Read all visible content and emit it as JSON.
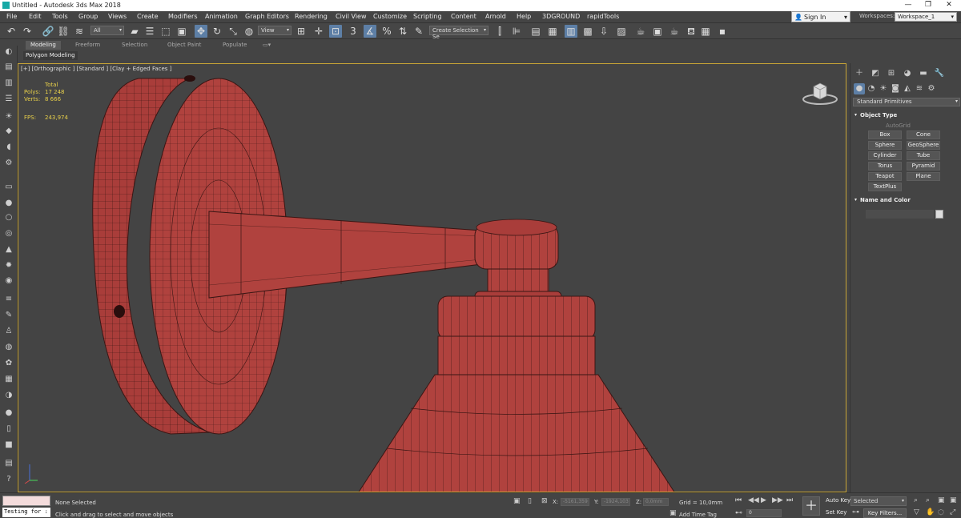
{
  "window": {
    "title": "Untitled - Autodesk 3ds Max 2018",
    "controls": [
      "—",
      "❐",
      "✕"
    ]
  },
  "menubar": {
    "items": [
      "File",
      "Edit",
      "Tools",
      "Group",
      "Views",
      "Create",
      "Modifiers",
      "Animation",
      "Graph Editors",
      "Rendering",
      "Civil View",
      "Customize",
      "Scripting",
      "Content",
      "Arnold",
      "Help",
      "3DGROUND",
      "rapidTools"
    ],
    "sign_in": "Sign In",
    "workspaces_label": "Workspaces:",
    "workspace_value": "Workspace_1"
  },
  "toolbar": {
    "filter_value": "All",
    "ref_coord_value": "View",
    "named_selection_value": "Create Selection Se",
    "icons": [
      "undo-icon",
      "redo-icon",
      "link-icon",
      "unlink-icon",
      "bind-spacewarp-icon",
      "select-object-icon",
      "select-by-name-icon",
      "rect-selection-icon",
      "window-crossing-icon",
      "move-icon",
      "rotate-icon",
      "scale-icon",
      "place-icon",
      "pivot-icon",
      "manipulate-icon",
      "keyboard-shortcut-icon",
      "snaps-icon",
      "angle-snap-icon",
      "percent-snap-icon",
      "spinner-snap-icon",
      "mirror-icon",
      "align-icon",
      "layer-explorer-icon",
      "toggle-ribbon-icon",
      "scene-explorer-icon",
      "curve-editor-icon",
      "schematic-view-icon",
      "material-editor-icon",
      "render-setup-icon",
      "rendered-frame-icon",
      "render-icon",
      "render-iterative-icon",
      "max-script-icon"
    ]
  },
  "ribbon": {
    "tabs": [
      "Modeling",
      "Freeform",
      "Selection",
      "Object Paint",
      "Populate"
    ],
    "active_tab": "Modeling",
    "sub_label": "Polygon Modeling"
  },
  "viewport": {
    "label": "[+] [Orthographic ] [Standard ] [Clay + Edged Faces ]",
    "stats": {
      "total_label": "Total",
      "polys_label": "Polys:",
      "polys_value": "17 248",
      "verts_label": "Verts:",
      "verts_value": "8 666",
      "fps_label": "FPS:",
      "fps_value": "243,974"
    },
    "model_color": "#b0423e",
    "wire_color": "#3a1614"
  },
  "command_panel": {
    "category_value": "Standard Primitives",
    "object_type": {
      "heading": "Object Type",
      "autogrid": "AutoGrid",
      "buttons": [
        "Box",
        "Cone",
        "Sphere",
        "GeoSphere",
        "Cylinder",
        "Tube",
        "Torus",
        "Pyramid",
        "Teapot",
        "Plane",
        "TextPlus"
      ]
    },
    "name_and_color": {
      "heading": "Name and Color"
    }
  },
  "statusbar": {
    "maxscript_text": "Testing for :",
    "selection_status": "None Selected",
    "prompt": "Click and drag to select and move objects",
    "x_label": "X:",
    "x_value": "-5161,359",
    "y_label": "Y:",
    "y_value": "-1924,103",
    "z_label": "Z:",
    "z_value": "0,0mm",
    "grid": "Grid = 10,0mm",
    "add_time_tag": "Add Time Tag",
    "frame_value": "0",
    "auto_key": "Auto Key",
    "set_key": "Set Key",
    "selected_value": "Selected",
    "key_filters": "Key Filters..."
  },
  "colors": {
    "viewport_border": "#c9a536",
    "active_blue": "#5d7fa6",
    "stats_yellow": "#e8d04a"
  }
}
